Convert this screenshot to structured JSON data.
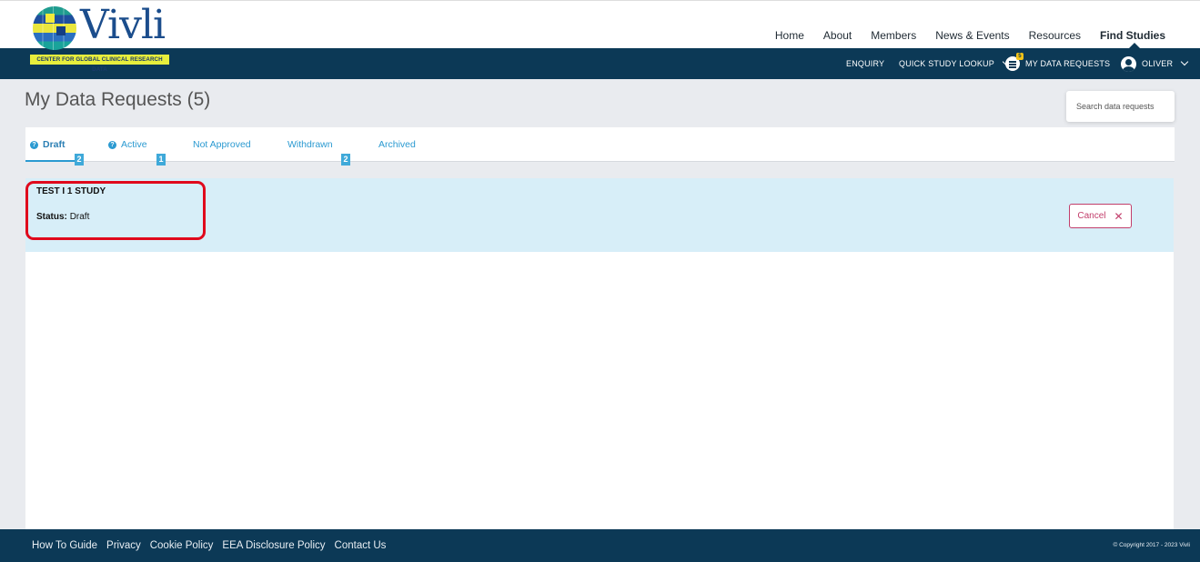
{
  "brand": {
    "name": "Vivli",
    "tagline": "CENTER FOR GLOBAL CLINICAL RESEARCH DATA"
  },
  "top_nav": [
    {
      "label": "Home",
      "active": false
    },
    {
      "label": "About",
      "active": false
    },
    {
      "label": "Members",
      "active": false
    },
    {
      "label": "News & Events",
      "active": false
    },
    {
      "label": "Resources",
      "active": false
    },
    {
      "label": "Find Studies",
      "active": true
    }
  ],
  "secondary_nav": {
    "enquiry": "ENQUIRY",
    "quick_lookup": "QUICK STUDY LOOKUP",
    "data_requests": "MY DATA REQUESTS",
    "data_requests_badge": "5",
    "user": "OLIVER"
  },
  "page": {
    "title": "My Data Requests (5)",
    "search_placeholder": "Search data requests"
  },
  "tabs": [
    {
      "label": "Draft",
      "active": true,
      "has_help": true,
      "badge": "2"
    },
    {
      "label": "Active",
      "active": false,
      "has_help": true,
      "badge": "1"
    },
    {
      "label": "Not Approved",
      "active": false,
      "has_help": false,
      "badge": ""
    },
    {
      "label": "Withdrawn",
      "active": false,
      "has_help": false,
      "badge": "2"
    },
    {
      "label": "Archived",
      "active": false,
      "has_help": false,
      "badge": ""
    }
  ],
  "requests": [
    {
      "title": "TEST I 1 STUDY",
      "status_label": "Status:",
      "status_value": "Draft",
      "cancel_label": "Cancel"
    }
  ],
  "footer": {
    "links": [
      "How To Guide",
      "Privacy",
      "Cookie Policy",
      "EEA Disclosure Policy",
      "Contact Us"
    ],
    "copyright": "© Copyright 2017 - 2023 Vivli"
  },
  "colors": {
    "navy": "#0c3956",
    "accent_blue": "#2b9ad1",
    "highlight_red": "#e0091c",
    "cancel_pink": "#c23e6b"
  }
}
